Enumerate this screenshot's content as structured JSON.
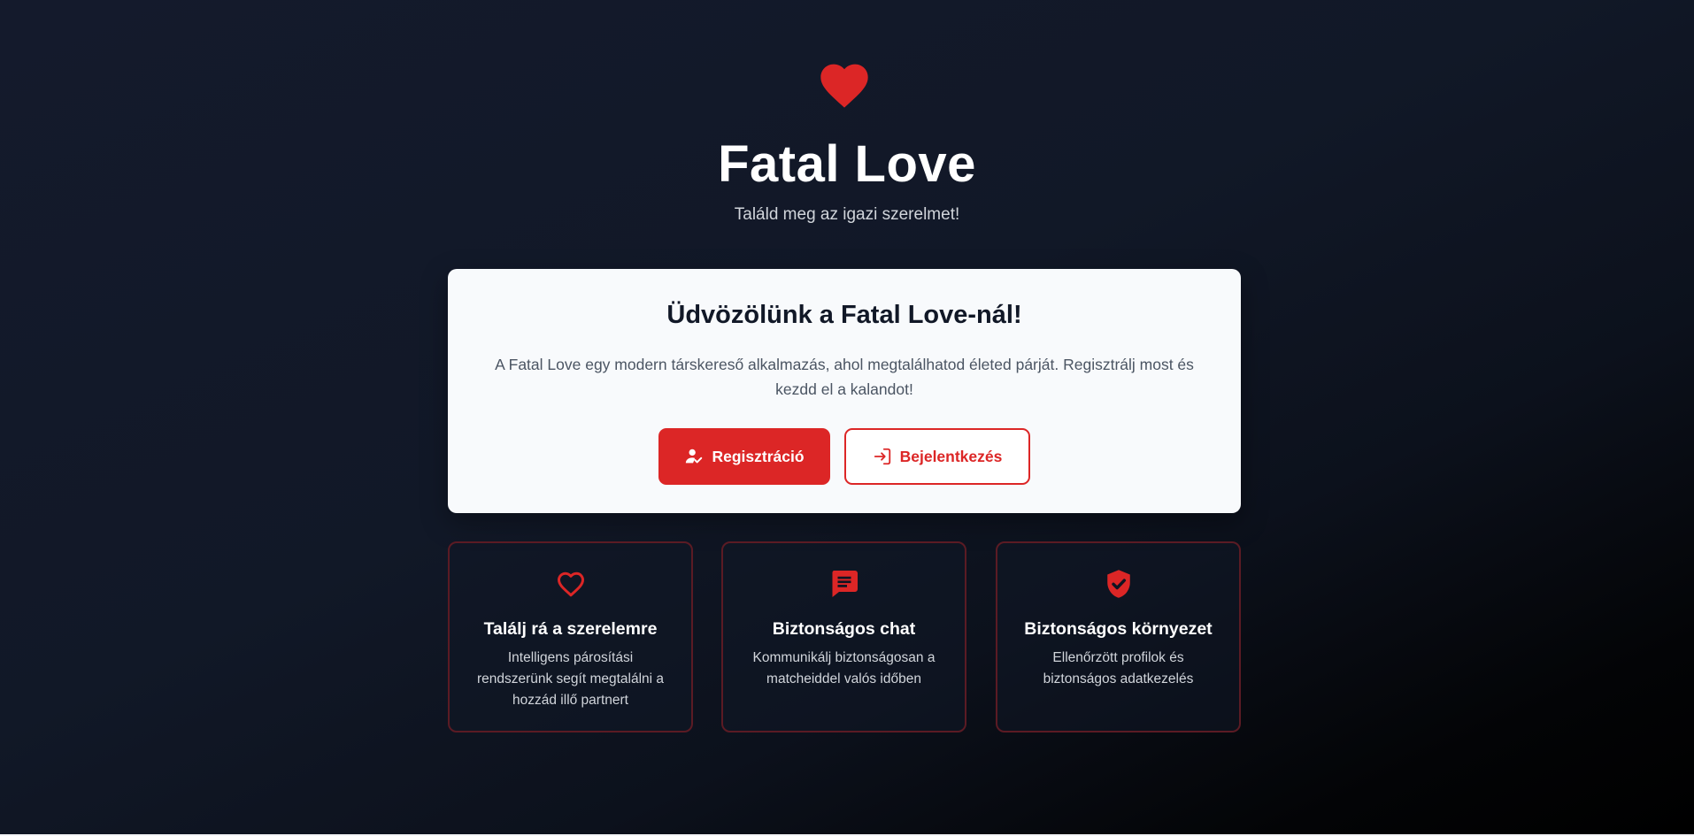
{
  "hero": {
    "icon": "heart-icon",
    "title": "Fatal Love",
    "subtitle": "Találd meg az igazi szerelmet!"
  },
  "welcome": {
    "title": "Üdvözölünk a Fatal Love-nál!",
    "text": "A Fatal Love egy modern társkereső alkalmazás, ahol megtalálhatod életed párját. Regisztrálj most és kezdd el a kalandot!",
    "register_label": "Regisztráció",
    "register_icon": "user-check-icon",
    "login_label": "Bejelentkezés",
    "login_icon": "login-icon"
  },
  "features": [
    {
      "icon": "heart-outline-icon",
      "title": "Találj rá a szerelemre",
      "text": "Intelligens párosítási rendszerünk segít megtalálni a hozzád illő partnert"
    },
    {
      "icon": "chat-icon",
      "title": "Biztonságos chat",
      "text": "Kommunikálj biztonságosan a matcheiddel valós időben"
    },
    {
      "icon": "shield-check-icon",
      "title": "Biztonságos környezet",
      "text": "Ellenőrzött profilok és biztonságos adatkezelés"
    }
  ],
  "colors": {
    "accent": "#dc2626",
    "background": "#111827",
    "card": "#f8fafc",
    "feature_border": "#5b1b24"
  }
}
